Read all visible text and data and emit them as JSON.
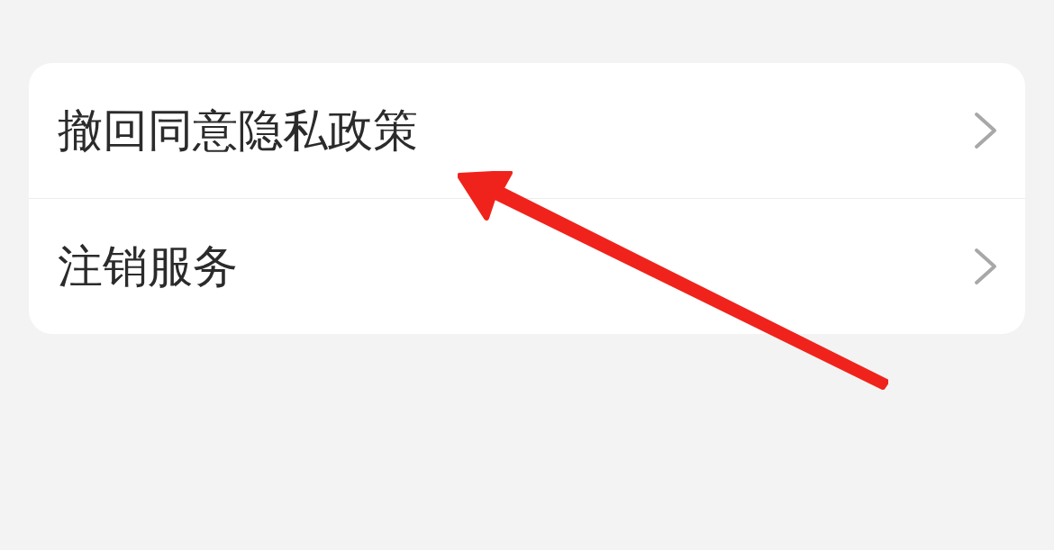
{
  "settings_list": [
    {
      "label": "撤回同意隐私政策"
    },
    {
      "label": "注销服务"
    }
  ]
}
